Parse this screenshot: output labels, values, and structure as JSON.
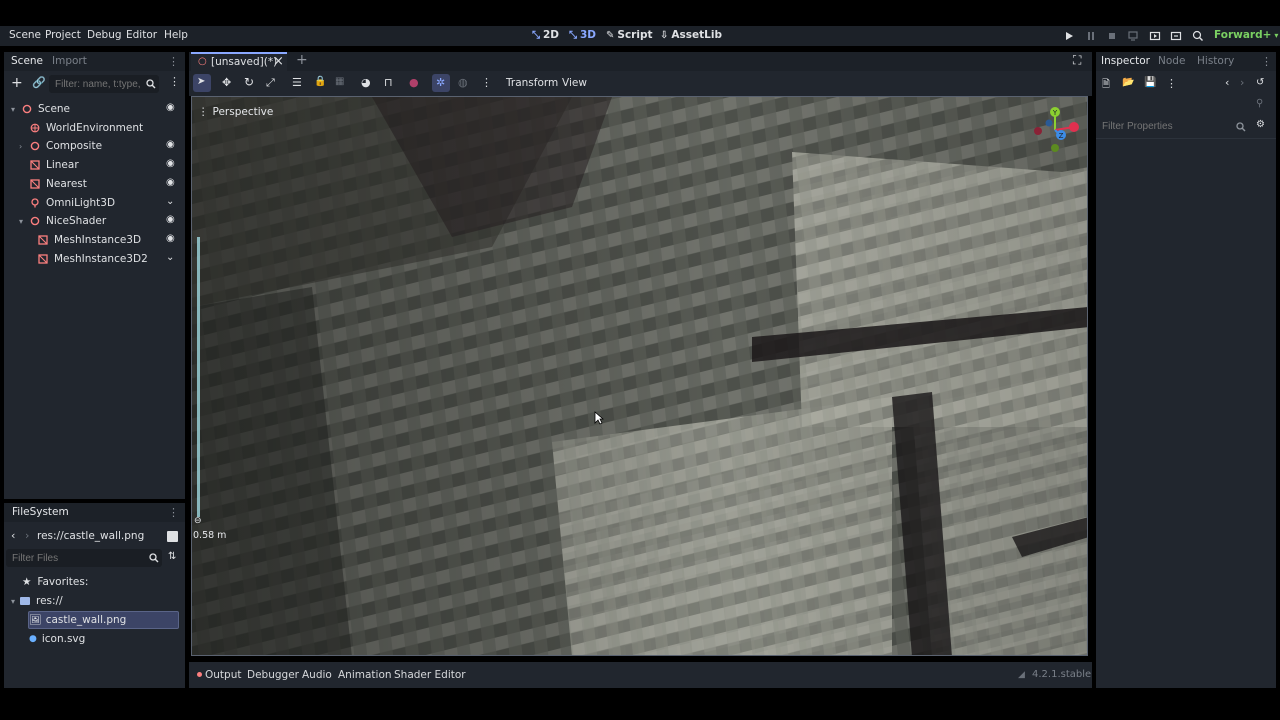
{
  "menubar": {
    "items": [
      "Scene",
      "Project",
      "Debug",
      "Editor",
      "Help"
    ],
    "main_tabs": [
      "2D",
      "3D",
      "Script",
      "AssetLib"
    ],
    "renderer": "Forward+"
  },
  "scene_dock": {
    "tabs": [
      "Scene",
      "Import"
    ],
    "filter_placeholder": "Filter: name, t:type,",
    "nodes": [
      {
        "label": "Scene",
        "icon": "node3d-icon",
        "color": "#fc7f7f"
      },
      {
        "label": "WorldEnvironment",
        "icon": "globe-icon",
        "color": "#fc7f7f"
      },
      {
        "label": "Composite",
        "icon": "node3d-icon",
        "color": "#fc7f7f"
      },
      {
        "label": "Linear",
        "icon": "mesh-icon",
        "color": "#fc7f7f"
      },
      {
        "label": "Nearest",
        "icon": "mesh-icon",
        "color": "#fc7f7f"
      },
      {
        "label": "OmniLight3D",
        "icon": "light-icon",
        "color": "#fc7f7f"
      },
      {
        "label": "NiceShader",
        "icon": "node3d-icon",
        "color": "#fc7f7f"
      },
      {
        "label": "MeshInstance3D",
        "icon": "mesh-icon",
        "color": "#fc7f7f"
      },
      {
        "label": "MeshInstance3D2",
        "icon": "mesh-icon",
        "color": "#fc7f7f"
      }
    ]
  },
  "filesystem_dock": {
    "title": "FileSystem",
    "path": "res://castle_wall.png",
    "filter_placeholder": "Filter Files",
    "favorites_label": "Favorites:",
    "root_label": "res://",
    "files": [
      "castle_wall.png",
      "icon.svg"
    ]
  },
  "editor_tab": {
    "label": "[unsaved](*)"
  },
  "toolbar": {
    "transform_label": "Transform",
    "view_label": "View"
  },
  "viewport": {
    "perspective_label": "Perspective",
    "zoom_readout": "0.58 m",
    "gizmo": {
      "x_color": "#e0304f",
      "y_color": "#8cd030",
      "z_color": "#3c8ce6"
    }
  },
  "bottom_panel": {
    "tabs": [
      "Output",
      "Debugger",
      "Audio",
      "Animation",
      "Shader Editor"
    ],
    "version": "4.2.1.stable"
  },
  "inspector_dock": {
    "tabs": [
      "Inspector",
      "Node",
      "History"
    ],
    "filter_placeholder": "Filter Properties"
  },
  "colors": {
    "accent": "#8aa8ff",
    "panel_bg": "#21262e",
    "bar_bg": "#1c2128",
    "selection": "#3c4466",
    "node_red": "#fc7f7f"
  }
}
